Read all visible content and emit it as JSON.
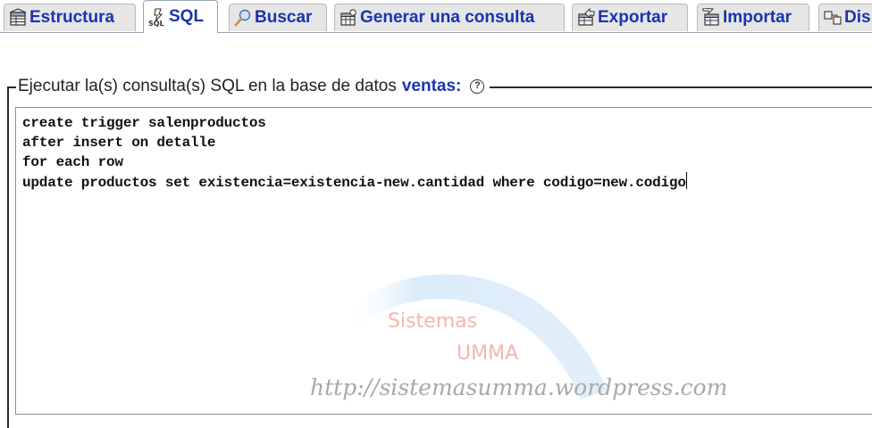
{
  "tabs": [
    {
      "label": "Estructura",
      "icon": "structure-icon",
      "active": false
    },
    {
      "label": "SQL",
      "icon": "sql-icon",
      "active": true
    },
    {
      "label": "Buscar",
      "icon": "search-icon",
      "active": false
    },
    {
      "label": "Generar una consulta",
      "icon": "query-builder-icon",
      "active": false
    },
    {
      "label": "Exportar",
      "icon": "export-icon",
      "active": false
    },
    {
      "label": "Importar",
      "icon": "import-icon",
      "active": false
    },
    {
      "label": "Dis",
      "icon": "designer-icon",
      "active": false
    }
  ],
  "query_panel": {
    "legend_text": "Ejecutar la(s) consulta(s) SQL en la base de datos",
    "database_name": "ventas:",
    "help_icon": "help-icon",
    "sql_lines": [
      "create trigger salenproductos",
      "after insert on detalle",
      "for each row",
      "update productos set existencia=existencia-new.cantidad where codigo=new.codigo"
    ]
  },
  "watermark": {
    "line1": "Sistemas",
    "line2": "UMMA",
    "url": "http://sistemasumma.wordpress.com"
  },
  "colors": {
    "link_blue": "#1a33b0",
    "watermark_pink": "#f3b6ae",
    "watermark_arc": "#dfeefa"
  }
}
